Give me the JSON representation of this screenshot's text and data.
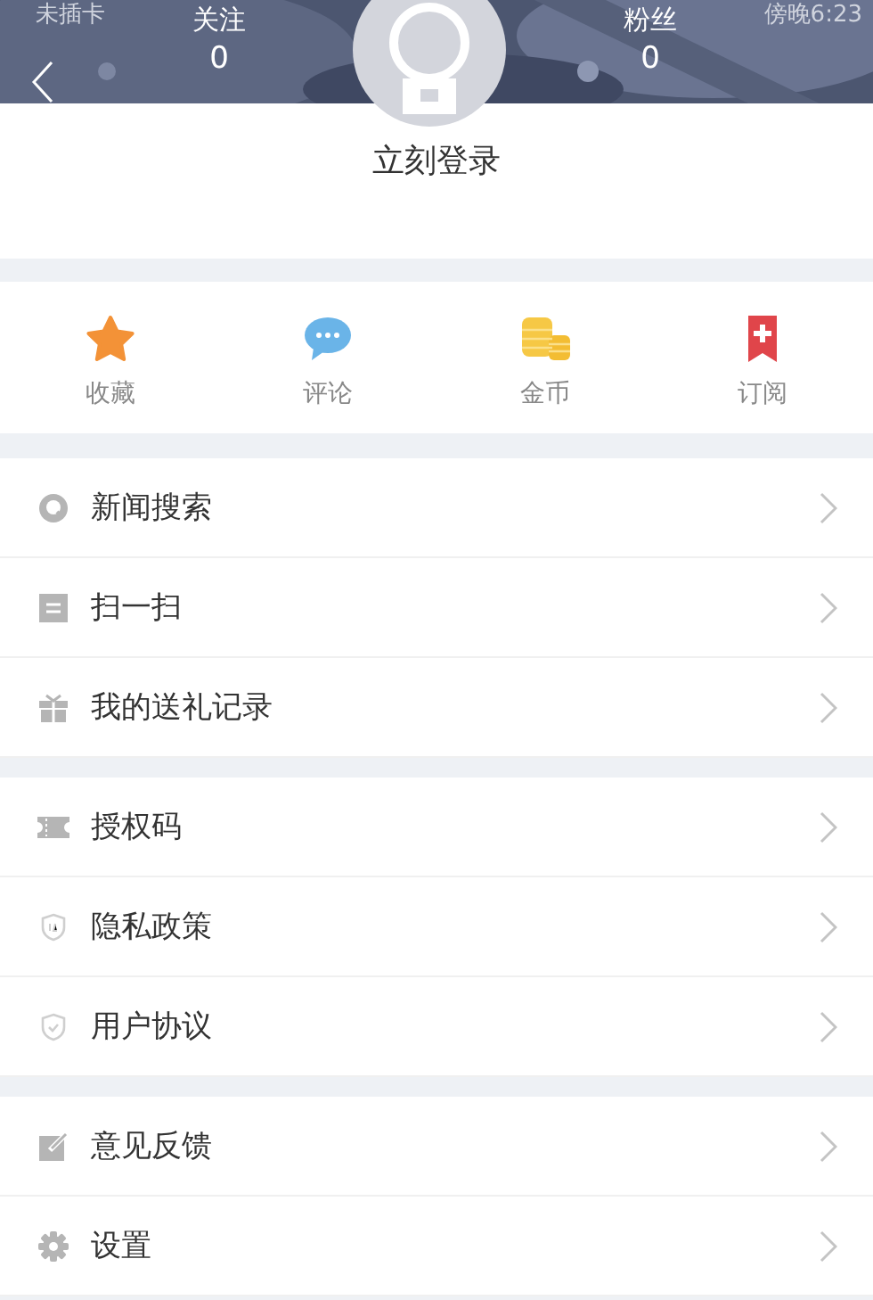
{
  "status_bar": {
    "carrier": "未插卡",
    "time": "傍晚6:23"
  },
  "header": {
    "stats": [
      {
        "label": "关注",
        "value": "0"
      },
      {
        "label": "粉丝",
        "value": "0"
      }
    ]
  },
  "login_label": "立刻登录",
  "quick_actions": [
    {
      "kind": "star",
      "label": "收藏"
    },
    {
      "kind": "chat",
      "label": "评论"
    },
    {
      "kind": "coins",
      "label": "金币"
    },
    {
      "kind": "bookmark",
      "label": "订阅"
    }
  ],
  "menu_groups": [
    [
      {
        "kind": "search",
        "label": "新闻搜索"
      },
      {
        "kind": "scan",
        "label": "扫一扫"
      },
      {
        "kind": "gift",
        "label": "我的送礼记录"
      }
    ],
    [
      {
        "kind": "ticket",
        "label": "授权码"
      },
      {
        "kind": "privacy",
        "label": "隐私政策"
      },
      {
        "kind": "shield",
        "label": "用户协议"
      }
    ],
    [
      {
        "kind": "edit",
        "label": "意见反馈"
      },
      {
        "kind": "gear",
        "label": "设置"
      }
    ]
  ]
}
